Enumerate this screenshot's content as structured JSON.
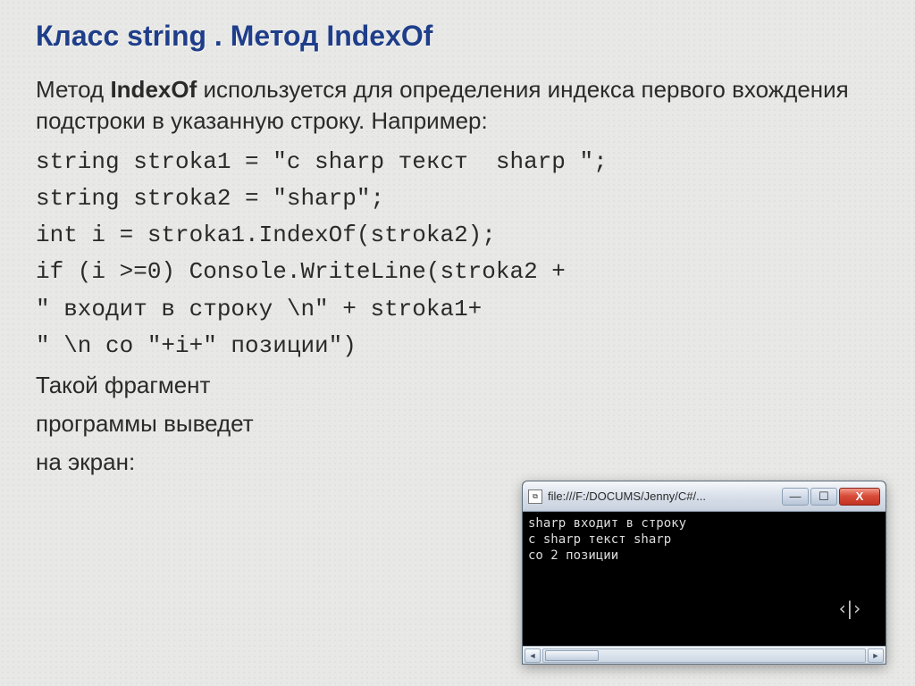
{
  "title": "Класс string . Метод IndexOf",
  "intro_pre": "Метод ",
  "intro_bold": "IndexOf",
  "intro_post": " используется для определения индекса первого вхождения подстроки в указанную строку. Например:",
  "code": {
    "l1": "string stroka1 = \"c sharp текст  sharp \";",
    "l2": "string stroka2 = \"sharp\";",
    "l3": "int i = stroka1.IndexOf(stroka2);",
    "l4": "if (i >=0) Console.WriteLine(stroka2 +",
    "l5": "\" входит в строку \\n\" + stroka1+",
    "l6": "\" \\n со \"+i+\" позиции\")"
  },
  "outro_l1": "Такой фрагмент",
  "outro_l2": "программы выведет",
  "outro_l3": "на экран:",
  "window": {
    "title": "file:///F:/DOCUMS/Jenny/C#/...",
    "console_l1": "sharp входит в строку",
    "console_l2": "c sharp текст  sharp",
    "console_l3": "со 2 позиции",
    "min": "—",
    "max": "☐",
    "close": "X",
    "left": "◄",
    "right": "►",
    "caret": "‹|›"
  }
}
